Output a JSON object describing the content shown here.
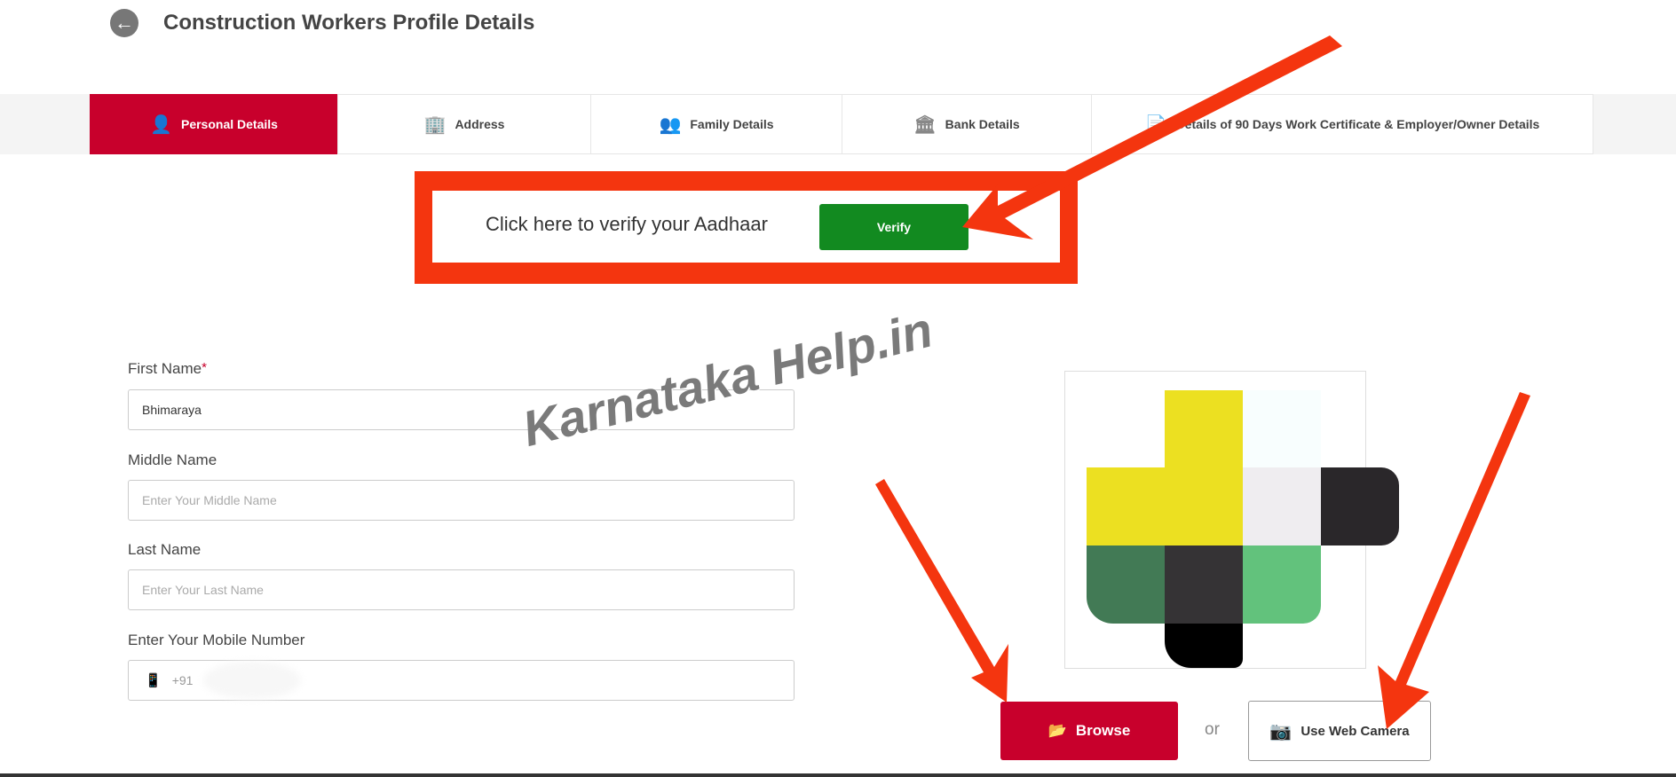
{
  "header": {
    "title": "Construction Workers Profile Details",
    "back_icon": "arrow-left-circle-icon"
  },
  "tabs": [
    {
      "label": "Personal Details",
      "icon": "user-check-icon",
      "active": true
    },
    {
      "label": "Address",
      "icon": "building-icon",
      "active": false
    },
    {
      "label": "Family Details",
      "icon": "family-icon",
      "active": false
    },
    {
      "label": "Bank Details",
      "icon": "bank-icon",
      "active": false
    },
    {
      "label": "Details of 90 Days Work Certificate & Employer/Owner Details",
      "icon": "certificate-icon",
      "active": false
    }
  ],
  "aadhaar": {
    "text": "Click here to verify your Aadhaar",
    "button": "Verify"
  },
  "form": {
    "first_name": {
      "label": "First Name",
      "required": "*",
      "value": "Bhimaraya"
    },
    "middle_name": {
      "label": "Middle Name",
      "placeholder": "Enter Your Middle Name"
    },
    "last_name": {
      "label": "Last Name",
      "placeholder": "Enter Your Last Name"
    },
    "mobile": {
      "label": "Enter Your Mobile Number",
      "prefix": "+91"
    }
  },
  "photo": {
    "browse": "Browse",
    "or": "or",
    "webcam": "Use Web Camera"
  },
  "watermark": "Karnataka Help.in",
  "colors": {
    "accent": "#c8002c",
    "verify": "#128a20",
    "annotation": "#f4350f"
  }
}
